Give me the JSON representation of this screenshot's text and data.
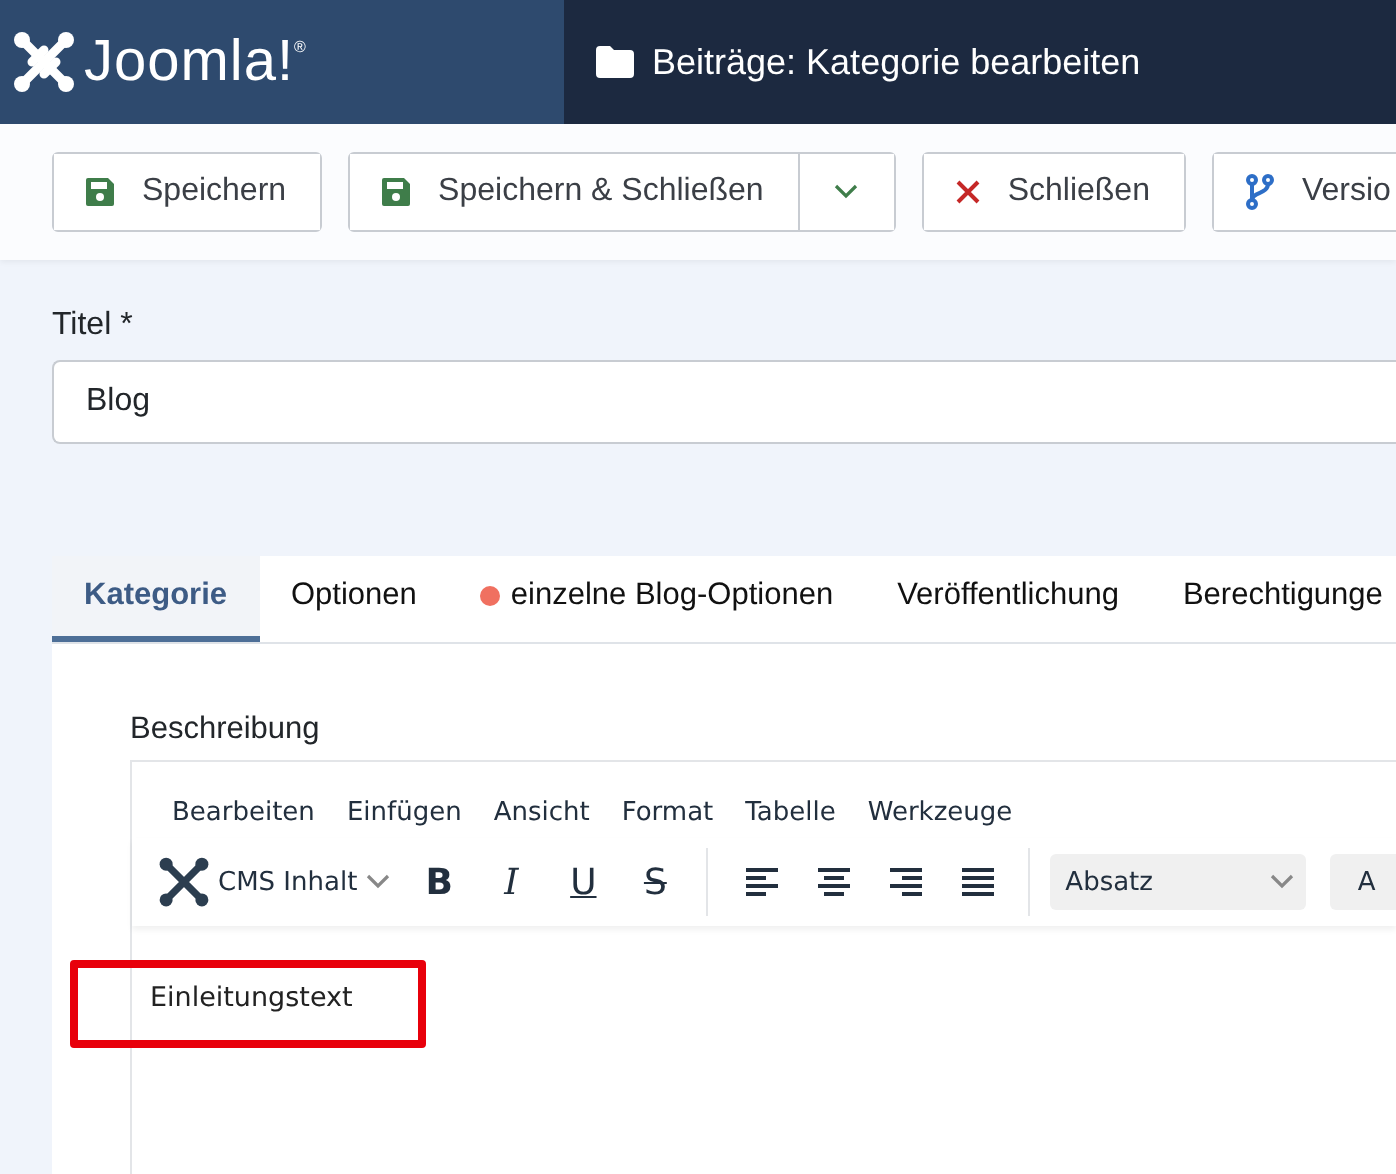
{
  "header": {
    "logo": "Joomla!$^{®}$",
    "title": "Beiträge: Kategorie bearbeiten"
  },
  "toolbar": [
    {
      "kind": "save",
      "label": "Speichern",
      "dropdown": false
    },
    {
      "kind": "save",
      "label": "Speichern & Schließen",
      "dropdown": true
    },
    {
      "kind": "close",
      "label": "Schließen",
      "dropdown": false
    },
    {
      "kind": "versions",
      "label": "Versio",
      "dropdown": false
    }
  ],
  "title_field": {
    "label": "Titel *",
    "value": "Blog"
  },
  "tabs": [
    {
      "label": "Kategorie",
      "selected": true,
      "marked": false
    },
    {
      "label": "Optionen",
      "selected": false,
      "marked": false
    },
    {
      "label": "einzelne Blog-Optionen",
      "selected": false,
      "marked": true
    },
    {
      "label": "Veröffentlichung",
      "selected": false,
      "marked": false
    },
    {
      "label": "Berechtigunge",
      "selected": false,
      "marked": false
    }
  ],
  "editor": {
    "label": "Beschreibung",
    "menubar": [
      "Bearbeiten",
      "Einfügen",
      "Ansicht",
      "Format",
      "Tabelle",
      "Werkzeuge"
    ],
    "cms_menu": "CMS Inhalt",
    "format_buttons": [
      {
        "kind": "bold",
        "label": "B"
      },
      {
        "kind": "italic",
        "label": "I"
      },
      {
        "kind": "underline",
        "label": "U"
      },
      {
        "kind": "strike",
        "label": "S"
      }
    ],
    "align_buttons": [
      {
        "kind": "left"
      },
      {
        "kind": "center"
      },
      {
        "kind": "right"
      },
      {
        "kind": "justify"
      }
    ],
    "block_format": "Absatz",
    "next_select": "A",
    "content": "Einleitungstext",
    "highlight": true
  }
}
